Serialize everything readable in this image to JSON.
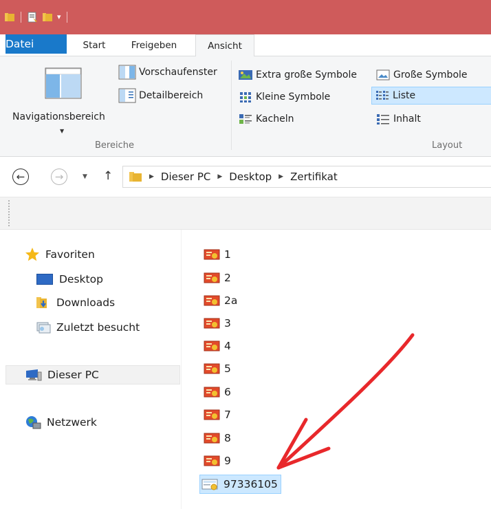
{
  "ribbon": {
    "tabs": {
      "file": "Datei",
      "start": "Start",
      "share": "Freigeben",
      "view": "Ansicht"
    },
    "groups": {
      "panes": {
        "label": "Bereiche",
        "navigation_pane": "Navigationsbereich",
        "preview_pane": "Vorschaufenster",
        "details_pane": "Detailbereich"
      },
      "layout": {
        "label": "Layout",
        "extra_large": "Extra große Symbole",
        "large": "Große Symbole",
        "small": "Kleine Symbole",
        "list": "Liste",
        "tiles": "Kacheln",
        "content": "Inhalt",
        "selected": "Liste"
      }
    }
  },
  "address": {
    "breadcrumb": [
      "Dieser PC",
      "Desktop",
      "Zertifikat"
    ]
  },
  "navpane": {
    "favorites": "Favoriten",
    "desktop": "Desktop",
    "downloads": "Downloads",
    "recent": "Zuletzt besucht",
    "this_pc": "Dieser PC",
    "network": "Netzwerk"
  },
  "files": [
    "1",
    "2",
    "2a",
    "3",
    "4",
    "5",
    "6",
    "7",
    "8",
    "9",
    "97336105"
  ],
  "selected_file": "97336105",
  "colors": {
    "titlebar": "#cf5b5b",
    "file_tab": "#1979ca",
    "selection": "#cce8ff",
    "annotation_arrow": "#e8282b"
  }
}
